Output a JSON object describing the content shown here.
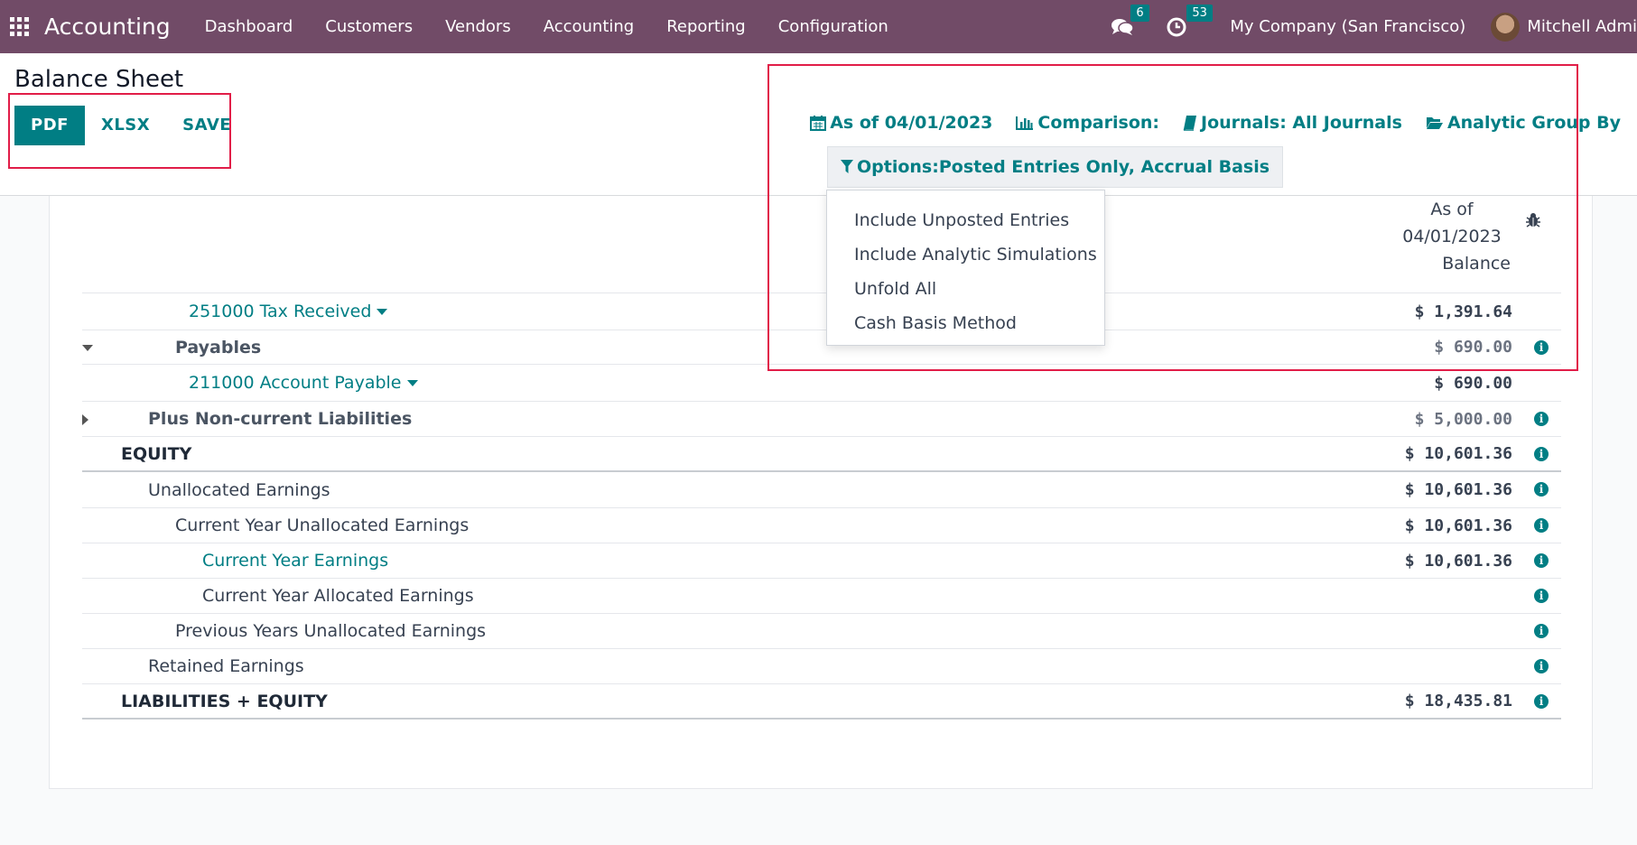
{
  "nav": {
    "brand": "Accounting",
    "menu": [
      "Dashboard",
      "Customers",
      "Vendors",
      "Accounting",
      "Reporting",
      "Configuration"
    ],
    "messages_count": "6",
    "activities_count": "53",
    "company": "My Company (San Francisco)",
    "user": "Mitchell Admi"
  },
  "page": {
    "title": "Balance Sheet",
    "buttons": {
      "pdf": "PDF",
      "xlsx": "XLSX",
      "save": "SAVE"
    }
  },
  "filters": {
    "date": "As of 04/01/2023",
    "comparison": "Comparison:",
    "journals": "Journals: All Journals",
    "analytic": "Analytic Group By",
    "options": "Options:Posted Entries Only, Accrual Basis"
  },
  "options_menu": [
    "Include Unposted Entries",
    "Include Analytic Simulations",
    "Unfold All",
    "Cash Basis Method"
  ],
  "column_header": {
    "line1": "As of",
    "line2": "04/01/2023",
    "line3": "Balance"
  },
  "rows": [
    {
      "label": "251000 Tax Received",
      "amount": "$ 1,391.64"
    },
    {
      "label": "Payables",
      "amount": "$ 690.00"
    },
    {
      "label": "211000 Account Payable",
      "amount": "$ 690.00"
    },
    {
      "label": "Plus Non-current Liabilities",
      "amount": "$ 5,000.00"
    },
    {
      "label": "EQUITY",
      "amount": "$ 10,601.36"
    },
    {
      "label": "Unallocated Earnings",
      "amount": "$ 10,601.36"
    },
    {
      "label": "Current Year Unallocated Earnings",
      "amount": "$ 10,601.36"
    },
    {
      "label": "Current Year Earnings",
      "amount": "$ 10,601.36"
    },
    {
      "label": "Current Year Allocated Earnings",
      "amount": ""
    },
    {
      "label": "Previous Years Unallocated Earnings",
      "amount": ""
    },
    {
      "label": "Retained Earnings",
      "amount": ""
    },
    {
      "label": "LIABILITIES + EQUITY",
      "amount": "$ 18,435.81"
    }
  ],
  "colors": {
    "nav": "#714b67",
    "accent": "#017e84",
    "highlight": "#e11d48"
  }
}
